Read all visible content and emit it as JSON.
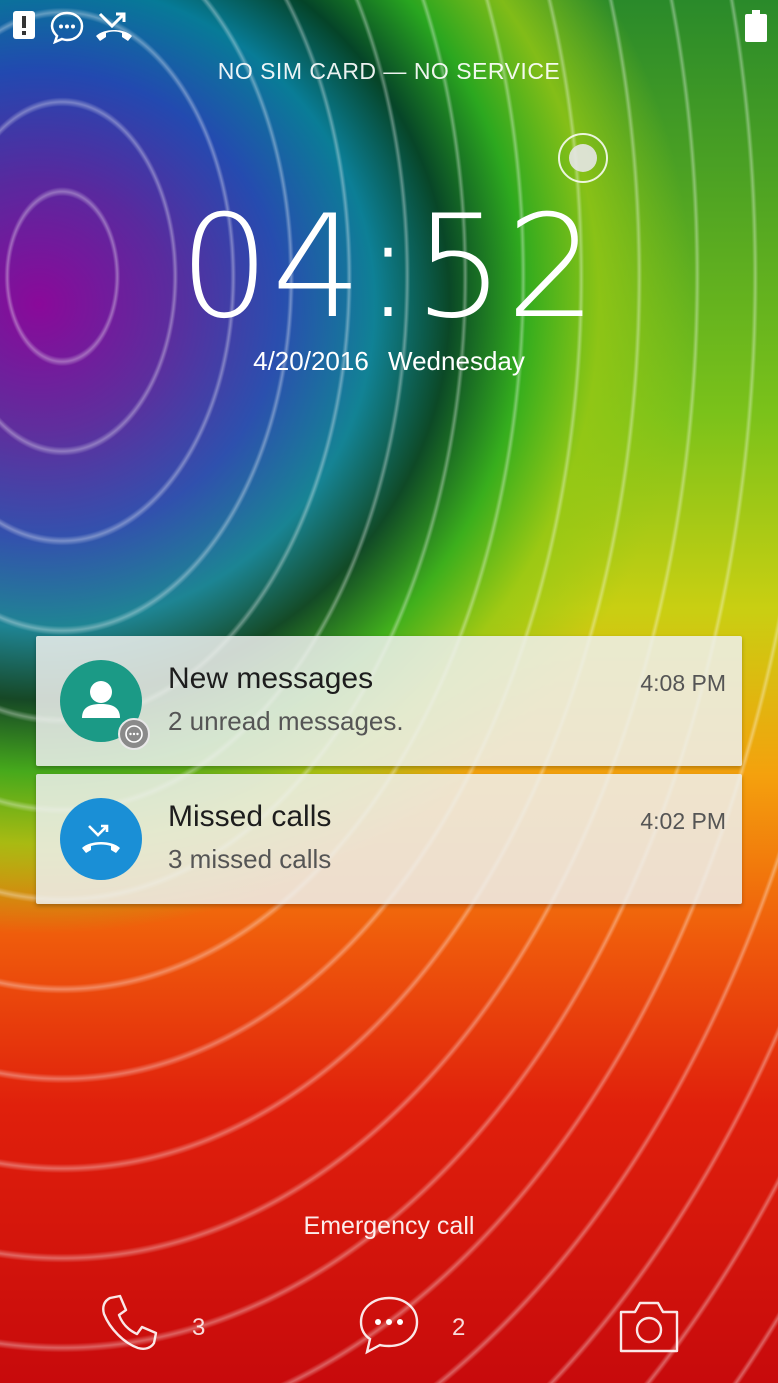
{
  "status_bar": {
    "icons": [
      "alert-icon",
      "message-icon",
      "missed-call-icon",
      "battery-icon"
    ]
  },
  "lockscreen": {
    "carrier_text": "NO SIM CARD — NO SERVICE",
    "time": "04:52",
    "date": "4/20/2016",
    "weekday": "Wednesday",
    "emergency_label": "Emergency call"
  },
  "notifications": [
    {
      "title": "New messages",
      "subtitle": "2 unread messages.",
      "time": "4:08 PM",
      "icon": "person-icon",
      "badge_icon": "chat-bubble-icon",
      "color": "#1b9a86"
    },
    {
      "title": "Missed calls",
      "subtitle": "3 missed calls",
      "time": "4:02 PM",
      "icon": "missed-call-icon",
      "color": "#1a8fd6"
    }
  ],
  "bottom_bar": {
    "phone_count": "3",
    "messages_count": "2",
    "icons": [
      "phone-icon",
      "message-icon",
      "camera-icon"
    ]
  }
}
